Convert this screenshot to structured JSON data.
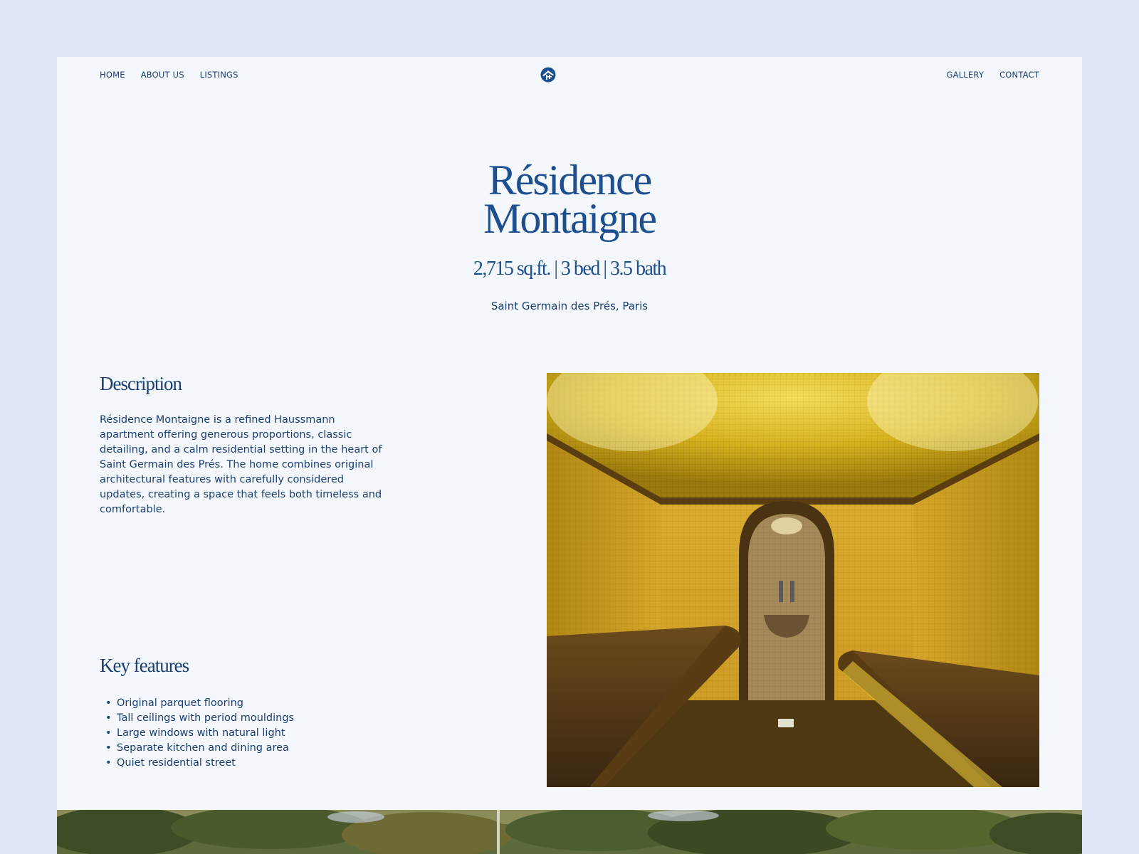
{
  "nav": {
    "left": [
      "HOME",
      "ABOUT US",
      "LISTINGS"
    ],
    "right": [
      "GALLERY",
      "CONTACT"
    ],
    "logo_icon": "house-emblem-icon"
  },
  "hero": {
    "title_line1": "Résidence",
    "title_line2": "Montaigne",
    "specs": "2,715 sq.ft. | 3 bed | 3.5 bath",
    "location": "Saint Germain des Prés, Paris"
  },
  "description": {
    "heading": "Description",
    "text": "Résidence Montaigne is a refined Haussmann apartment offering generous proportions, classic detailing, and a calm residential setting in the heart of Saint Germain des Prés. The home combines original architectural features with carefully considered updates, creating a space that feels both timeless and comfortable."
  },
  "features": {
    "heading": "Key features",
    "items": [
      "Original parquet flooring",
      "Tall ceilings with period mouldings",
      "Large windows with natural light",
      "Separate kitchen and dining area",
      "Quiet residential street"
    ]
  },
  "colors": {
    "page_bg": "#dfe8f6",
    "panel_bg": "#f4f8fd",
    "title_blue": "#1d4e90",
    "text_navy": "#1b3e73",
    "photo_gold": "#c9a21a"
  }
}
